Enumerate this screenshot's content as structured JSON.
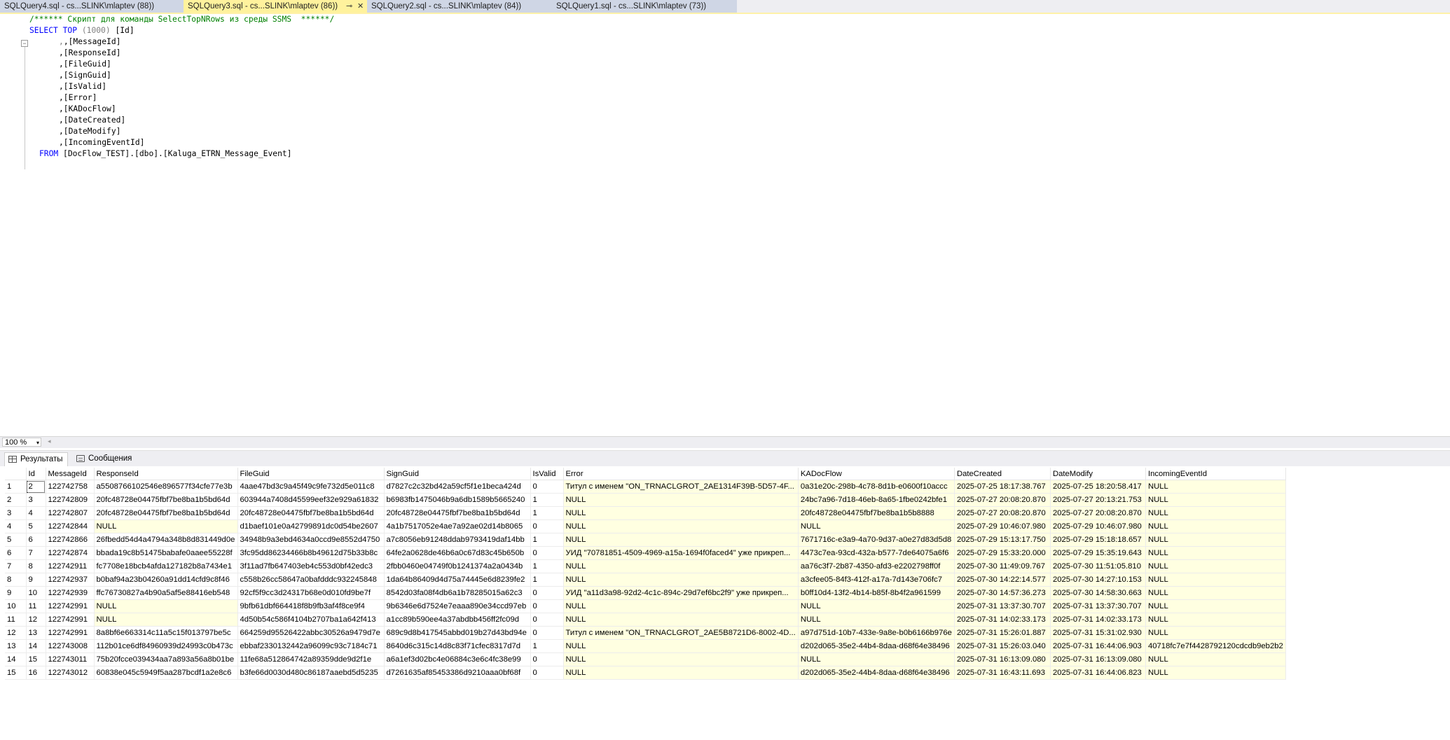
{
  "tabs": [
    {
      "label": "SQLQuery4.sql - cs...SLINK\\mlaptev (88))",
      "active": false
    },
    {
      "label": "SQLQuery3.sql - cs...SLINK\\mlaptev (86))",
      "active": true
    },
    {
      "label": "SQLQuery2.sql - cs...SLINK\\mlaptev (84))",
      "active": false
    },
    {
      "label": "SQLQuery1.sql - cs...SLINK\\mlaptev (73))",
      "active": false
    }
  ],
  "editor": {
    "comment": "/****** Скрипт для команды SelectTopNRows из среды SSMS  ******/",
    "select_kw": "SELECT",
    "top_kw": "TOP",
    "top_value": "(1000)",
    "first_col": " [Id]",
    "columns": [
      ",[MessageId]",
      ",[ResponseId]",
      ",[FileGuid]",
      ",[SignGuid]",
      ",[IsValid]",
      ",[Error]",
      ",[KADocFlow]",
      ",[DateCreated]",
      ",[DateModify]",
      ",[IncomingEventId]"
    ],
    "from_kw": "FROM",
    "from_target": " [DocFlow_TEST].[dbo].[Kaluga_ETRN_Message_Event]",
    "fold_symbol": "−"
  },
  "zoom": {
    "value": "100 %",
    "arrow": "▾",
    "scroll_left": "◂"
  },
  "results_tabs": [
    {
      "label": "Результаты",
      "icon": "grid-icon",
      "active": true
    },
    {
      "label": "Сообщения",
      "icon": "messages-icon",
      "active": false
    }
  ],
  "colors": {
    "null_cell": "#ffffe1",
    "tab_active": "#fff29d",
    "keyword": "#0000ff",
    "comment": "#008000"
  },
  "grid": {
    "columns": [
      "Id",
      "MessageId",
      "ResponseId",
      "FileGuid",
      "SignGuid",
      "IsValid",
      "Error",
      "KADocFlow",
      "DateCreated",
      "DateModify",
      "IncomingEventId"
    ],
    "rows": [
      [
        "1",
        "2",
        "122742758",
        "a5508766102546e896577f34cfe77e3b",
        "4aae47bd3c9a45f49c9fe732d5e011c8",
        "d7827c2c32bd42a59cf5f1e1beca424d",
        "0",
        "Титул с именем \"ON_TRNACLGROT_2AE1314F39B-5D57-4F...",
        "0a31e20c-298b-4c78-8d1b-e0600f10accc",
        "2025-07-25 18:17:38.767",
        "2025-07-25 18:20:58.417",
        "NULL"
      ],
      [
        "2",
        "3",
        "122742809",
        "20fc48728e04475fbf7be8ba1b5bd64d",
        "603944a7408d45599eef32e929a61832",
        "b6983fb1475046b9a6db1589b5665240",
        "1",
        "NULL",
        "24bc7a96-7d18-46eb-8a65-1fbe0242bfe1",
        "2025-07-27 20:08:20.870",
        "2025-07-27 20:13:21.753",
        "NULL"
      ],
      [
        "3",
        "4",
        "122742807",
        "20fc48728e04475fbf7be8ba1b5bd64d",
        "20fc48728e04475fbf7be8ba1b5bd64d",
        "20fc48728e04475fbf7be8ba1b5bd64d",
        "1",
        "NULL",
        "20fc48728e04475fbf7be8ba1b5b8888",
        "2025-07-27 20:08:20.870",
        "2025-07-27 20:08:20.870",
        "NULL"
      ],
      [
        "4",
        "5",
        "122742844",
        "NULL",
        "d1baef101e0a42799891dc0d54be2607",
        "4a1b7517052e4ae7a92ae02d14b8065",
        "0",
        "NULL",
        "NULL",
        "2025-07-29 10:46:07.980",
        "2025-07-29 10:46:07.980",
        "NULL"
      ],
      [
        "5",
        "6",
        "122742866",
        "26fbedd54d4a4794a348b8d831449d0e",
        "34948b9a3ebd4634a0ccd9e8552d4750",
        "a7c8056eb91248ddab9793419daf14bb",
        "1",
        "NULL",
        "7671716c-e3a9-4a70-9d37-a0e27d83d5d8",
        "2025-07-29 15:13:17.750",
        "2025-07-29 15:18:18.657",
        "NULL"
      ],
      [
        "6",
        "7",
        "122742874",
        "bbada19c8b51475babafe0aaee55228f",
        "3fc95dd86234466b8b49612d75b33b8c",
        "64fe2a0628de46b6a0c67d83c45b650b",
        "0",
        "УИД \"70781851-4509-4969-a15a-1694f0faced4\" уже прикреп...",
        "4473c7ea-93cd-432a-b577-7de64075a6f6",
        "2025-07-29 15:33:20.000",
        "2025-07-29 15:35:19.643",
        "NULL"
      ],
      [
        "7",
        "8",
        "122742911",
        "fc7708e18bcb4afda127182b8a7434e1",
        "3f11ad7fb647403eb4c553d0bf42edc3",
        "2fbb0460e04749f0b1241374a2a0434b",
        "1",
        "NULL",
        "aa76c3f7-2b87-4350-afd3-e2202798ff0f",
        "2025-07-30 11:49:09.767",
        "2025-07-30 11:51:05.810",
        "NULL"
      ],
      [
        "8",
        "9",
        "122742937",
        "b0baf94a23b04260a91dd14cfd9c8f46",
        "c558b26cc58647a0bafdddc932245848",
        "1da64b86409d4d75a74445e6d8239fe2",
        "1",
        "NULL",
        "a3cfee05-84f3-412f-a17a-7d143e706fc7",
        "2025-07-30 14:22:14.577",
        "2025-07-30 14:27:10.153",
        "NULL"
      ],
      [
        "9",
        "10",
        "122742939",
        "ffc76730827a4b90a5af5e88416eb548",
        "92cf5f9cc3d24317b68e0d010fd9be7f",
        "8542d03fa08f4db6a1b78285015a62c3",
        "0",
        "УИД \"a11d3a98-92d2-4c1c-894c-29d7ef6bc2f9\" уже прикреп...",
        "b0ff10d4-13f2-4b14-b85f-8b4f2a961599",
        "2025-07-30 14:57:36.273",
        "2025-07-30 14:58:30.663",
        "NULL"
      ],
      [
        "10",
        "11",
        "122742991",
        "NULL",
        "9bfb61dbf664418f8b9fb3af4f8ce9f4",
        "9b6346e6d7524e7eaaa890e34ccd97eb",
        "0",
        "NULL",
        "NULL",
        "2025-07-31 13:37:30.707",
        "2025-07-31 13:37:30.707",
        "NULL"
      ],
      [
        "11",
        "12",
        "122742991",
        "NULL",
        "4d50b54c586f4104b2707ba1a642f413",
        "a1cc89b590ee4a37abdbb456ff2fc09d",
        "0",
        "NULL",
        "NULL",
        "2025-07-31 14:02:33.173",
        "2025-07-31 14:02:33.173",
        "NULL"
      ],
      [
        "12",
        "13",
        "122742991",
        "8a8bf6e663314c11a5c15f013797be5c",
        "664259d95526422abbc30526a9479d7e",
        "689c9d8b417545abbd019b27d43bd94e",
        "0",
        "Титул с именем \"ON_TRNACLGROT_2AE5B8721D6-8002-4D...",
        "a97d751d-10b7-433e-9a8e-b0b6166b976e",
        "2025-07-31 15:26:01.887",
        "2025-07-31 15:31:02.930",
        "NULL"
      ],
      [
        "13",
        "14",
        "122743008",
        "112b01ce6df84960939d24993c0b473c",
        "ebbaf2330132442a96099c93c7184c71",
        "8640d6c315c14d8c83f71cfec8317d7d",
        "1",
        "NULL",
        "d202d065-35e2-44b4-8daa-d68f64e38496",
        "2025-07-31 15:26:03.040",
        "2025-07-31 16:44:06.903",
        "40718fc7e7f4428792120cdcdb9eb2b2"
      ],
      [
        "14",
        "15",
        "122743011",
        "75b20fcce039434aa7a893a56a8b01be",
        "11fe68a512864742a89359dde9d2f1e",
        "a6a1ef3d02bc4e06884c3e6c4fc38e99",
        "0",
        "NULL",
        "NULL",
        "2025-07-31 16:13:09.080",
        "2025-07-31 16:13:09.080",
        "NULL"
      ],
      [
        "15",
        "16",
        "122743012",
        "60838e045c5949f5aa287bcdf1a2e8c6",
        "b3fe66d0030d480c86187aaebd5d5235",
        "d7261635af85453386d9210aaa0bf68f",
        "0",
        "NULL",
        "d202d065-35e2-44b4-8daa-d68f64e38496",
        "2025-07-31 16:43:11.693",
        "2025-07-31 16:44:06.823",
        "NULL"
      ]
    ]
  }
}
